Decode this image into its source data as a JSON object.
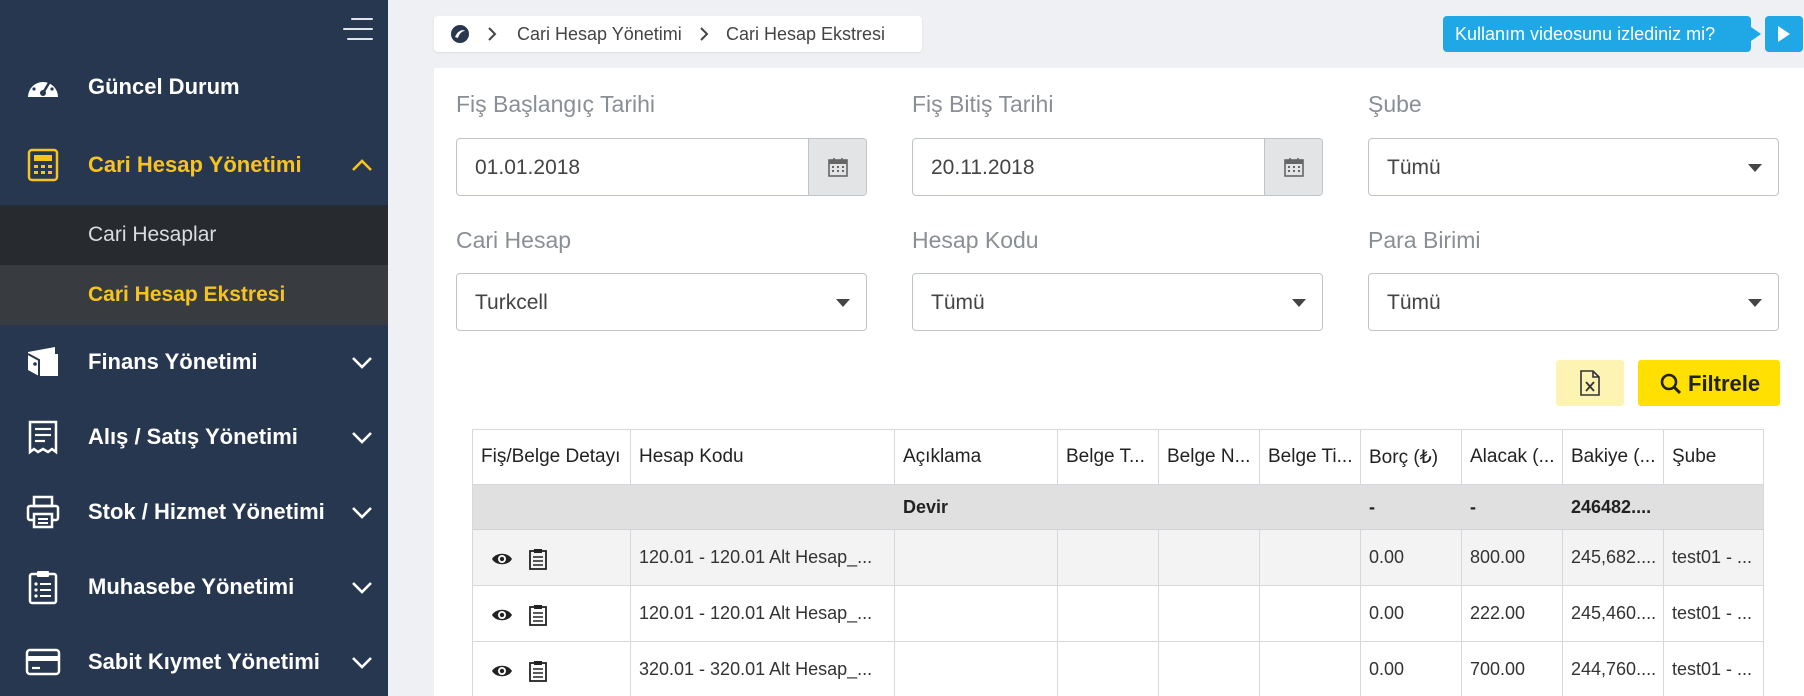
{
  "sidebar": {
    "items": [
      {
        "label": "Güncel Durum",
        "icon": "dashboard-gauge-icon"
      },
      {
        "label": "Cari Hesap Yönetimi",
        "icon": "calculator-icon",
        "expanded": true
      },
      {
        "label": "Finans Yönetimi",
        "icon": "wallet-icon"
      },
      {
        "label": "Alış / Satış Yönetimi",
        "icon": "receipt-icon"
      },
      {
        "label": "Stok / Hizmet Yönetimi",
        "icon": "printer-icon"
      },
      {
        "label": "Muhasebe Yönetimi",
        "icon": "clipboard-icon"
      },
      {
        "label": "Sabit Kıymet Yönetimi",
        "icon": "credit-card-icon"
      }
    ],
    "subitems": [
      {
        "label": "Cari Hesaplar"
      },
      {
        "label": "Cari Hesap Ekstresi",
        "active": true
      }
    ]
  },
  "breadcrumb": {
    "items": [
      "Cari Hesap Yönetimi",
      "Cari Hesap Ekstresi"
    ]
  },
  "video_prompt": "Kullanım videosunu izlediniz mi?",
  "filters": {
    "start_date": {
      "label": "Fiş Başlangıç Tarihi",
      "value": "01.01.2018"
    },
    "end_date": {
      "label": "Fiş Bitiş Tarihi",
      "value": "20.11.2018"
    },
    "branch": {
      "label": "Şube",
      "value": "Tümü"
    },
    "account": {
      "label": "Cari Hesap",
      "value": "Turkcell"
    },
    "account_code": {
      "label": "Hesap Kodu",
      "value": "Tümü"
    },
    "currency": {
      "label": "Para Birimi",
      "value": "Tümü"
    }
  },
  "actions": {
    "excel_icon": "excel-export-icon",
    "filter_label": "Filtrele"
  },
  "table": {
    "headers": [
      "Fiş/Belge Detayı",
      "Hesap Kodu",
      "Açıklama",
      "Belge T...",
      "Belge N...",
      "Belge Ti...",
      "Borç (₺)",
      "Alacak (...",
      "Bakiye (...",
      "Şube"
    ],
    "devir": {
      "label": "Devir",
      "borc": "-",
      "alacak": "-",
      "bakiye": "246482...."
    },
    "rows": [
      {
        "hesap_kodu": "120.01 - 120.01 Alt Hesap_...",
        "borc": "0.00",
        "alacak": "800.00",
        "bakiye": "245,682....",
        "sube": "test01 - ..."
      },
      {
        "hesap_kodu": "120.01 - 120.01 Alt Hesap_...",
        "borc": "0.00",
        "alacak": "222.00",
        "bakiye": "245,460....",
        "sube": "test01 - ..."
      },
      {
        "hesap_kodu": "320.01 - 320.01 Alt Hesap_...",
        "borc": "0.00",
        "alacak": "700.00",
        "bakiye": "244,760....",
        "sube": "test01 - ..."
      }
    ]
  },
  "colors": {
    "sidebar_bg": "#26374f",
    "accent_yellow": "#f7c31e",
    "filter_button": "#ffe000",
    "video_button": "#1fa8e5"
  }
}
